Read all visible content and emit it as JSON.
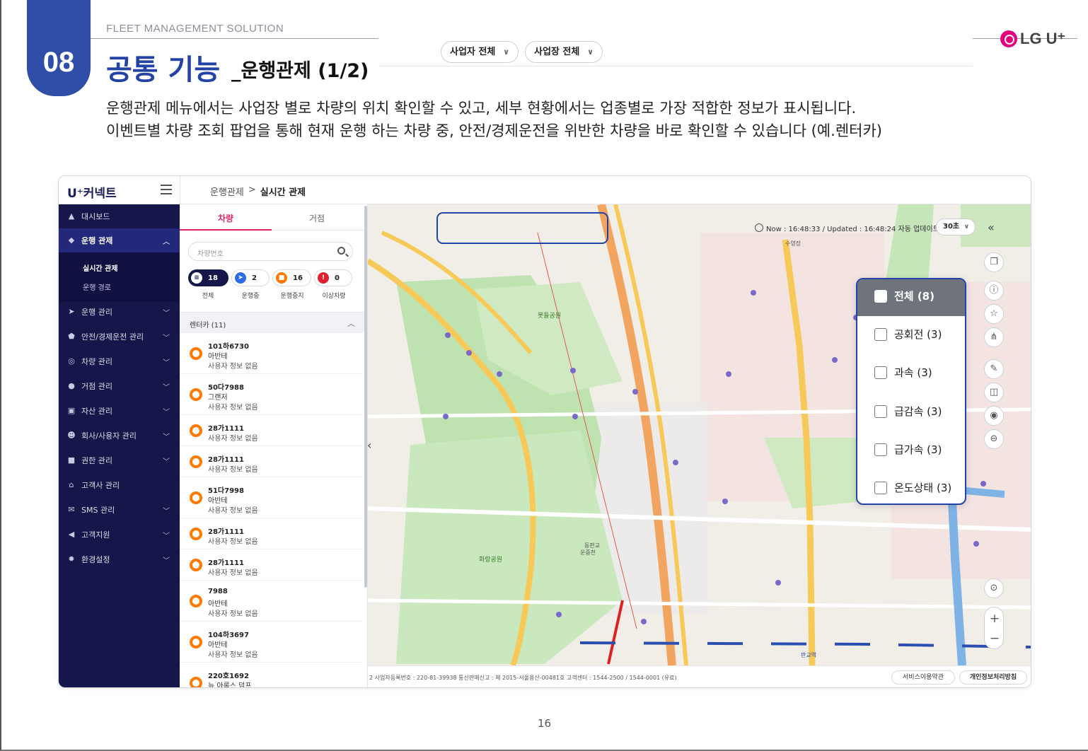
{
  "header": {
    "section_number": "08",
    "eyebrow": "FLEET MANAGEMENT SOLUTION",
    "title": "공통 기능",
    "subtitle": "_운행관제 (1/2)",
    "brand": "LG U⁺",
    "description_line1": "운행관제 메뉴에서는 사업장 별로 차량의 위치 확인할 수 있고, 세부 현황에서는 업종별로 가장 적합한 정보가 표시됩니다.",
    "description_line2": "이벤트별 차량 조회 팝업을 통해 현재 운행 하는 차량 중, 안전/경제운전을 위반한 차량을 바로 확인할 수 있습니다 (예.렌터카)"
  },
  "app": {
    "logo": "U⁺커넥트",
    "breadcrumb": {
      "parent": "운행관제",
      "separator": ">",
      "current": "실시간 관제"
    }
  },
  "sidebar": {
    "items": [
      {
        "label": "대시보드",
        "icon": "dashboard-icon"
      },
      {
        "label": "운행 관제",
        "icon": "diamond-nav-icon",
        "active": true
      },
      {
        "label": "운행 관리",
        "icon": "send-icon"
      },
      {
        "label": "안전/경제운전 관리",
        "icon": "shield-icon"
      },
      {
        "label": "차량 관리",
        "icon": "steering-icon"
      },
      {
        "label": "거점 관리",
        "icon": "pin-icon"
      },
      {
        "label": "자산 관리",
        "icon": "truck-icon"
      },
      {
        "label": "회사/사용자 관리",
        "icon": "users-icon"
      },
      {
        "label": "권한 관리",
        "icon": "lock-icon"
      },
      {
        "label": "고객사 관리",
        "icon": "home-icon"
      },
      {
        "label": "SMS 관리",
        "icon": "mail-icon"
      },
      {
        "label": "고객지원",
        "icon": "speaker-icon"
      },
      {
        "label": "환경설정",
        "icon": "gear-icon"
      }
    ],
    "sub_items": [
      "실시간 관제",
      "운행 경로"
    ]
  },
  "list": {
    "tabs": [
      "차량",
      "거점"
    ],
    "search_placeholder": "차량번호",
    "status": [
      {
        "count": "18",
        "label": "전체",
        "color": "#15174a"
      },
      {
        "count": "2",
        "label": "운행중",
        "color": "#2e6be6"
      },
      {
        "count": "16",
        "label": "운행중지",
        "color": "#ff7a00"
      },
      {
        "count": "0",
        "label": "이상차량",
        "color": "#e0202e"
      }
    ],
    "group": "렌터카 (11)",
    "vehicles": [
      {
        "plate": "101하6730",
        "model": "아반테",
        "user": "사용자 정보 없음"
      },
      {
        "plate": "50다7988",
        "model": "그랜저",
        "user": "사용자 정보 없음"
      },
      {
        "plate": "28가1111",
        "model": "",
        "user": "사용자 정보 없음"
      },
      {
        "plate": "28가1111",
        "model": "",
        "user": "사용자 정보 없음"
      },
      {
        "plate": "51다7998",
        "model": "아반테",
        "user": "사용자 정보 없음"
      },
      {
        "plate": "28가1111",
        "model": "",
        "user": "사용자 정보 없음"
      },
      {
        "plate": "28가1111",
        "model": "",
        "user": "사용자 정보 없음"
      },
      {
        "plate": "7988",
        "model": "아반테",
        "user": "사용자 정보 없음"
      },
      {
        "plate": "104하3697",
        "model": "아반테",
        "user": "사용자 정보 없음"
      },
      {
        "plate": "220호1692",
        "model": "뉴 아록스 덤프",
        "user": ""
      }
    ]
  },
  "map": {
    "filters": {
      "business": "사업자 전체",
      "site": "사업장 전체"
    },
    "update_text": "Now : 16:48:33 / Updated : 16:48:24 자동 업데이트",
    "interval": "30초",
    "event_popup": [
      {
        "label": "전체 (8)"
      },
      {
        "label": "공회전 (3)"
      },
      {
        "label": "과속 (3)"
      },
      {
        "label": "급감속 (3)"
      },
      {
        "label": "급가속 (3)"
      },
      {
        "label": "온도상태 (3)"
      }
    ],
    "labels": [
      "봇들공원",
      "화랑공원",
      "판교역",
      "수영장",
      "동판교",
      "운중천"
    ],
    "footer": {
      "info": "2   사업자등록번호 : 220-81-39938   통신판매신고 : 제 2015-서울용산-00481호   고객센터 : 1544-2500 / 1544-0001 (유료)",
      "terms": "서비스이용약관",
      "privacy": "개인정보처리방침"
    }
  },
  "page_number": "16",
  "colors": {
    "brand_blue": "#2443a6",
    "sidebar": "#15174a",
    "accent_pink": "#e0245e",
    "orange": "#ff7a00"
  }
}
